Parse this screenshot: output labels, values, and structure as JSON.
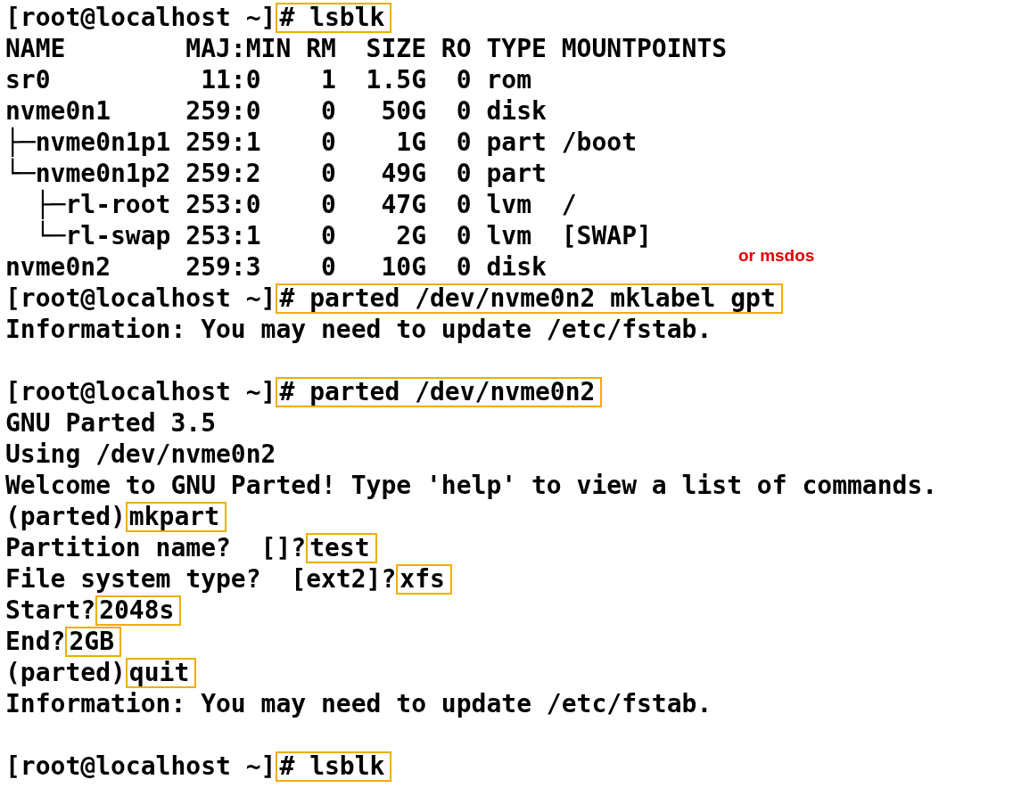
{
  "terminal": {
    "lines": [
      {
        "kind": "text",
        "segments": [
          {
            "kind": "plain",
            "text": "[root@localhost ~]"
          },
          {
            "kind": "boxed",
            "text": "# lsblk"
          }
        ]
      },
      {
        "kind": "text",
        "segments": [
          {
            "kind": "plain",
            "text": "NAME        MAJ:MIN RM  SIZE RO TYPE MOUNTPOINTS"
          }
        ]
      },
      {
        "kind": "text",
        "segments": [
          {
            "kind": "plain",
            "text": "sr0          11:0    1  1.5G  0 rom"
          }
        ]
      },
      {
        "kind": "text",
        "segments": [
          {
            "kind": "plain",
            "text": "nvme0n1     259:0    0   50G  0 disk"
          }
        ]
      },
      {
        "kind": "text",
        "segments": [
          {
            "kind": "plain",
            "text": "├─nvme0n1p1 259:1    0    1G  0 part /boot"
          }
        ]
      },
      {
        "kind": "text",
        "segments": [
          {
            "kind": "plain",
            "text": "└─nvme0n1p2 259:2    0   49G  0 part"
          }
        ]
      },
      {
        "kind": "text",
        "segments": [
          {
            "kind": "plain",
            "text": "  ├─rl-root 253:0    0   47G  0 lvm  /"
          }
        ]
      },
      {
        "kind": "text",
        "segments": [
          {
            "kind": "plain",
            "text": "  └─rl-swap 253:1    0    2G  0 lvm  [SWAP]"
          }
        ]
      },
      {
        "kind": "text",
        "segments": [
          {
            "kind": "plain",
            "text": "nvme0n2     259:3    0   10G  0 disk"
          },
          {
            "kind": "note",
            "text": "or msdos"
          }
        ]
      },
      {
        "kind": "text",
        "segments": [
          {
            "kind": "plain",
            "text": "[root@localhost ~]"
          },
          {
            "kind": "boxed",
            "text": "# parted /dev/nvme0n2 mklabel gpt"
          }
        ]
      },
      {
        "kind": "text",
        "segments": [
          {
            "kind": "plain",
            "text": "Information: You may need to update /etc/fstab."
          }
        ]
      },
      {
        "kind": "blank"
      },
      {
        "kind": "text",
        "segments": [
          {
            "kind": "plain",
            "text": "[root@localhost ~]"
          },
          {
            "kind": "boxed",
            "text": "# parted /dev/nvme0n2"
          }
        ]
      },
      {
        "kind": "text",
        "segments": [
          {
            "kind": "plain",
            "text": "GNU Parted 3.5"
          }
        ]
      },
      {
        "kind": "text",
        "segments": [
          {
            "kind": "plain",
            "text": "Using /dev/nvme0n2"
          }
        ]
      },
      {
        "kind": "text",
        "segments": [
          {
            "kind": "plain",
            "text": "Welcome to GNU Parted! Type 'help' to view a list of commands."
          }
        ]
      },
      {
        "kind": "text",
        "segments": [
          {
            "kind": "plain",
            "text": "(parted)"
          },
          {
            "kind": "boxed",
            "text": "mkpart"
          }
        ]
      },
      {
        "kind": "text",
        "segments": [
          {
            "kind": "plain",
            "text": "Partition name?  []?"
          },
          {
            "kind": "boxed",
            "text": "test"
          }
        ]
      },
      {
        "kind": "text",
        "segments": [
          {
            "kind": "plain",
            "text": "File system type?  [ext2]?"
          },
          {
            "kind": "boxed",
            "text": "xfs"
          }
        ]
      },
      {
        "kind": "text",
        "segments": [
          {
            "kind": "plain",
            "text": "Start?"
          },
          {
            "kind": "boxed",
            "text": "2048s"
          }
        ]
      },
      {
        "kind": "text",
        "segments": [
          {
            "kind": "plain",
            "text": "End?"
          },
          {
            "kind": "boxed",
            "text": "2GB"
          }
        ]
      },
      {
        "kind": "text",
        "segments": [
          {
            "kind": "plain",
            "text": "(parted)"
          },
          {
            "kind": "boxed",
            "text": "quit"
          }
        ]
      },
      {
        "kind": "text",
        "segments": [
          {
            "kind": "plain",
            "text": "Information: You may need to update /etc/fstab."
          }
        ]
      },
      {
        "kind": "blank"
      },
      {
        "kind": "text",
        "segments": [
          {
            "kind": "plain",
            "text": "[root@localhost ~]"
          },
          {
            "kind": "boxed",
            "text": "# lsblk"
          }
        ]
      }
    ]
  }
}
